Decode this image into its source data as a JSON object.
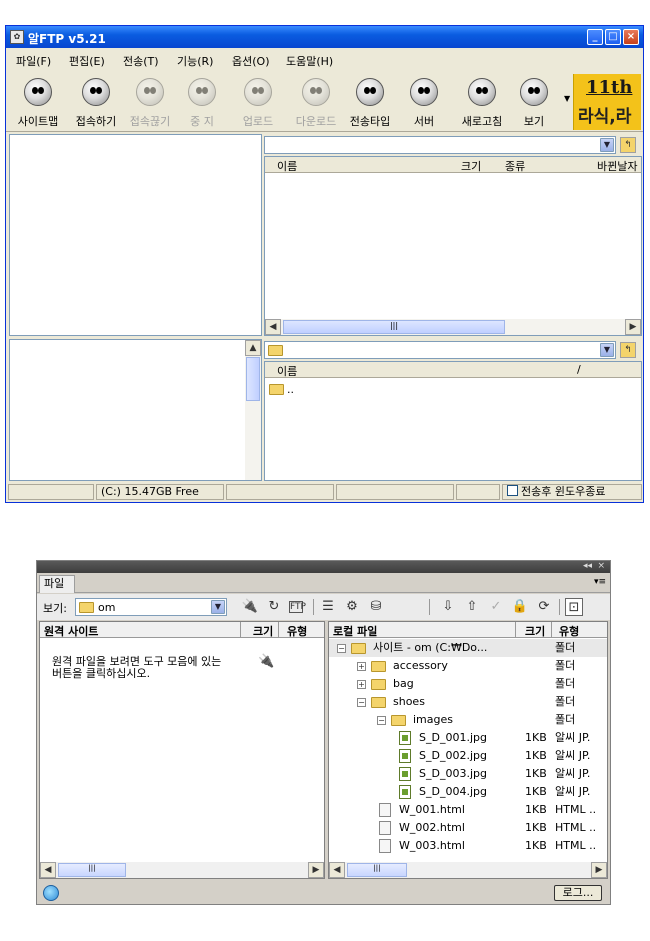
{
  "alftp": {
    "title": "알FTP v5.21",
    "menu": [
      "파일(F)",
      "편집(E)",
      "전송(T)",
      "기능(R)",
      "옵션(O)",
      "도움말(H)"
    ],
    "toolbar": [
      {
        "label": "사이트맵",
        "enabled": true
      },
      {
        "label": "접속하기",
        "enabled": true
      },
      {
        "label": "접속끊기",
        "enabled": false
      },
      {
        "label": "중 지",
        "enabled": false
      },
      {
        "label": "업로드",
        "enabled": false
      },
      {
        "label": "다운로드",
        "enabled": false
      },
      {
        "label": "전송타입",
        "enabled": true
      },
      {
        "label": "서버",
        "enabled": true
      },
      {
        "label": "새로고침",
        "enabled": true
      },
      {
        "label": "보기",
        "enabled": true
      }
    ],
    "badge": {
      "line1": "11th",
      "line2": "라식,라"
    },
    "remote_columns": [
      "이름",
      "크기",
      "종류",
      "바뀐날자"
    ],
    "local_columns": [
      "이름",
      "/"
    ],
    "local_item": "..",
    "status": {
      "drive": "(C:) 15.47GB Free",
      "close_after": "전송후 윈도우종료"
    }
  },
  "dw": {
    "tab": "파일",
    "view_label": "보기:",
    "site_select": "om",
    "remote": {
      "header_name": "원격 사이트",
      "header_size": "크기",
      "header_type": "유형",
      "message_line1": "원격 파일을 보려면 도구 모음에 있는",
      "message_line2": "버튼을 클릭하십시오."
    },
    "local": {
      "header_name": "로컬 파일",
      "header_size": "크기",
      "header_type": "유형",
      "rows": [
        {
          "name": "사이트 - om (C:₩Do...",
          "size": "",
          "type": "폴더",
          "level": 0,
          "kind": "folder",
          "toggle": "−"
        },
        {
          "name": "accessory",
          "size": "",
          "type": "폴더",
          "level": 1,
          "kind": "folder",
          "toggle": "+"
        },
        {
          "name": "bag",
          "size": "",
          "type": "폴더",
          "level": 1,
          "kind": "folder",
          "toggle": "+"
        },
        {
          "name": "shoes",
          "size": "",
          "type": "폴더",
          "level": 1,
          "kind": "folder",
          "toggle": "−"
        },
        {
          "name": "images",
          "size": "",
          "type": "폴더",
          "level": 2,
          "kind": "folder",
          "toggle": "−"
        },
        {
          "name": "S_D_001.jpg",
          "size": "1KB",
          "type": "알씨 JP.",
          "level": 3,
          "kind": "img",
          "toggle": ""
        },
        {
          "name": "S_D_002.jpg",
          "size": "1KB",
          "type": "알씨 JP.",
          "level": 3,
          "kind": "img",
          "toggle": ""
        },
        {
          "name": "S_D_003.jpg",
          "size": "1KB",
          "type": "알씨 JP.",
          "level": 3,
          "kind": "img",
          "toggle": ""
        },
        {
          "name": "S_D_004.jpg",
          "size": "1KB",
          "type": "알씨 JP.",
          "level": 3,
          "kind": "img",
          "toggle": ""
        },
        {
          "name": "W_001.html",
          "size": "1KB",
          "type": "HTML ..",
          "level": 2,
          "kind": "html",
          "toggle": ""
        },
        {
          "name": "W_002.html",
          "size": "1KB",
          "type": "HTML ..",
          "level": 2,
          "kind": "html",
          "toggle": ""
        },
        {
          "name": "W_003.html",
          "size": "1KB",
          "type": "HTML ..",
          "level": 2,
          "kind": "html",
          "toggle": ""
        }
      ]
    },
    "log_button": "로그..."
  }
}
